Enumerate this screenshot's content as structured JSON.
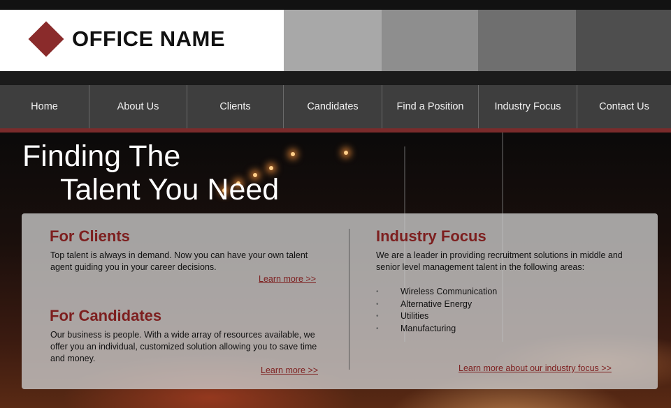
{
  "logo": {
    "text": "OFFICE NAME",
    "color": "#8a2b2b"
  },
  "header": {
    "swatch_colors": [
      "#a8a8a8",
      "#8e8e8e",
      "#6f6f6f",
      "#4e4e4e"
    ]
  },
  "nav": {
    "items": [
      {
        "label": "Home"
      },
      {
        "label": "About Us"
      },
      {
        "label": "Clients"
      },
      {
        "label": "Candidates"
      },
      {
        "label": "Find a Position"
      },
      {
        "label": "Industry Focus"
      },
      {
        "label": "Contact Us"
      }
    ]
  },
  "hero": {
    "line1": "Finding The",
    "line2": "Talent You Need"
  },
  "clients": {
    "heading": "For Clients",
    "body": "Top talent is always in demand. Now you can have your own talent agent guiding you in your career decisions.",
    "link": "Learn more >>"
  },
  "candidates": {
    "heading": "For Candidates",
    "body": "Our business is people. With a wide array of resources available, we offer you an individual, customized solution allowing you to save time and money.",
    "link": "Learn more >>"
  },
  "industry": {
    "heading": "Industry Focus",
    "body": "We are a leader in providing recruitment solutions in middle and senior level management talent in the following areas:",
    "items": [
      "Wireless Communication",
      "Alternative Energy",
      "Utilities",
      "Manufacturing"
    ],
    "link": "Learn more about our industry focus >>"
  },
  "colors": {
    "accent": "#7d1f1f",
    "nav_bg": "#3e3e3e",
    "nav_bar": "#7a2b2b"
  }
}
